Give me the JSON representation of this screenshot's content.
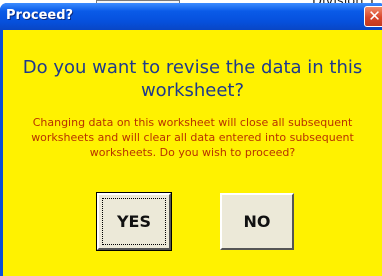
{
  "background": {
    "partial_text": "Division 1"
  },
  "dialog": {
    "title": "Proceed?",
    "close_glyph": "✕",
    "question": "Do you want to revise the data in this worksheet?",
    "message": "Changing data on this worksheet will close all subsequent worksheets and will clear all data entered into subsequent worksheets.  Do you wish to proceed?",
    "buttons": {
      "yes_label": "YES",
      "no_label": "NO"
    }
  },
  "colors": {
    "title_bar": "#0a5be8",
    "client_background": "#fff200",
    "question_text": "#1e3a8c",
    "message_text": "#b83200",
    "button_face": "#ece9d8",
    "close_button": "#d8462a"
  }
}
